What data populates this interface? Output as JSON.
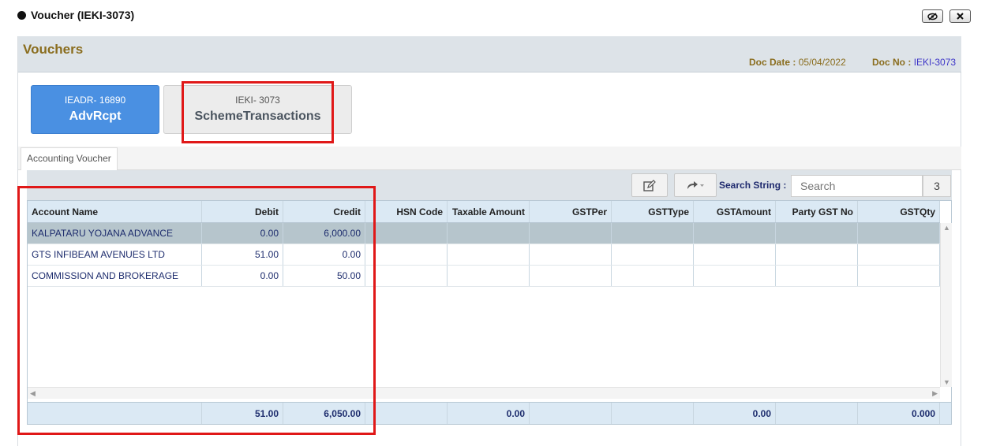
{
  "window": {
    "title": "Voucher (IEKI-3073)",
    "buttons": [
      "eye-slash-icon",
      "close-icon"
    ]
  },
  "panel": {
    "title": "Vouchers",
    "doc_date_label": "Doc Date :",
    "doc_date": "05/04/2022",
    "doc_no_label": "Doc No :",
    "doc_no": "IEKI-3073"
  },
  "tiles": [
    {
      "sub": "IEADR- 16890",
      "main": "AdvRcpt"
    },
    {
      "sub": "IEKI- 3073",
      "main": "SchemeTransactions"
    }
  ],
  "tabs": [
    {
      "label": "Accounting Voucher"
    }
  ],
  "toolbar": {
    "edit_icon": "edit-icon",
    "share_icon": "share-icon",
    "search_label": "Search String :",
    "search_placeholder": "Search",
    "search_count": "3"
  },
  "table": {
    "columns": [
      "Account Name",
      "Debit",
      "Credit",
      "HSN Code",
      "Taxable Amount",
      "GSTPer",
      "GSTType",
      "GSTAmount",
      "Party GST No",
      "GSTQty"
    ],
    "rows": [
      {
        "account": "KALPATARU YOJANA ADVANCE",
        "debit": "0.00",
        "credit": "6,000.00",
        "selected": true
      },
      {
        "account": "GTS INFIBEAM AVENUES LTD",
        "debit": "51.00",
        "credit": "0.00",
        "selected": false
      },
      {
        "account": "COMMISSION AND BROKERAGE",
        "debit": "0.00",
        "credit": "50.00",
        "selected": false
      }
    ],
    "totals": {
      "debit": "51.00",
      "credit": "6,050.00",
      "taxable_amount": "0.00",
      "gst_amount": "0.00",
      "gst_qty": "0.000"
    }
  },
  "colors": {
    "highlight_box": "#e01818",
    "tile_blue": "#4a90e2",
    "title_gold": "#8a6d1e"
  }
}
